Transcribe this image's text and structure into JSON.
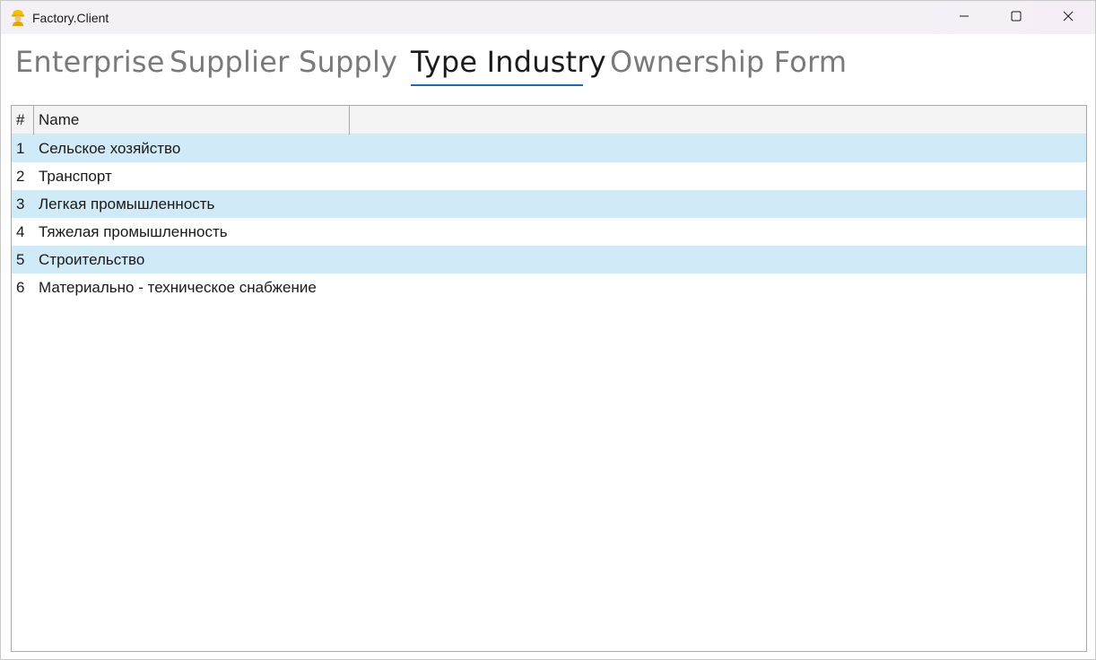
{
  "window": {
    "title": "Factory.Client",
    "icon": "worker-icon",
    "controls": [
      "minimize-icon",
      "maximize-icon",
      "close-icon"
    ]
  },
  "tabs": [
    {
      "label": "Enterprise",
      "active": false
    },
    {
      "label": "Supplier",
      "active": false
    },
    {
      "label": "Supply",
      "active": false
    },
    {
      "label": "Type Industry",
      "active": true
    },
    {
      "label": "Ownership Form",
      "active": false
    }
  ],
  "grid": {
    "columns": [
      "#",
      "Name"
    ],
    "rows": [
      {
        "num": "1",
        "name": "Сельское хозяйство"
      },
      {
        "num": "2",
        "name": "Транспорт"
      },
      {
        "num": "3",
        "name": "Легкая промышленность"
      },
      {
        "num": "4",
        "name": "Тяжелая промышленность"
      },
      {
        "num": "5",
        "name": "Строительство"
      },
      {
        "num": "6",
        "name": "Материально - техническое снабжение"
      }
    ]
  },
  "colors": {
    "accent": "#1c6bb8",
    "row_alt": "#d0eaf7",
    "tab_inactive": "#7a7a7a"
  }
}
